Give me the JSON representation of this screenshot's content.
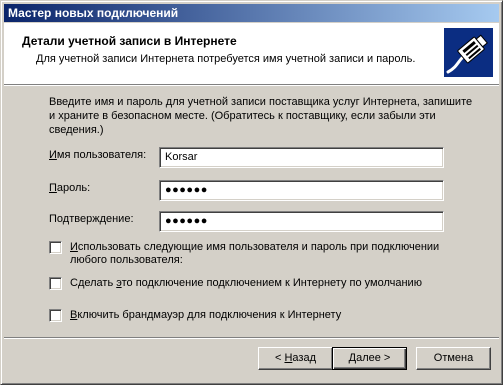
{
  "window": {
    "title": "Мастер новых подключений"
  },
  "header": {
    "title": "Детали учетной записи в Интернете",
    "subtitle": "Для учетной записи Интернета потребуется имя учетной записи и пароль.",
    "icon": "network-cable-icon"
  },
  "intro_text": "Введите имя и пароль для учетной записи поставщика услуг Интернета, запишите и храните в безопасном месте. (Обратитесь к поставщику, если забыли эти сведения.)",
  "fields": {
    "username": {
      "label_pre": "",
      "label_accel": "И",
      "label_post": "мя пользователя:",
      "value": "Korsar"
    },
    "password": {
      "label_pre": "",
      "label_accel": "П",
      "label_post": "ароль:",
      "value": "●●●●●●"
    },
    "confirm": {
      "label_pre": "По",
      "label_accel": "д",
      "label_post": "тверждение:",
      "value": "●●●●●●"
    }
  },
  "checkboxes": {
    "use_for_all": {
      "label_pre": "",
      "label_accel": "И",
      "label_post": "спользовать следующие имя пользователя и пароль при подключении любого пользователя:",
      "checked": false
    },
    "default_connection": {
      "label_pre": "Сделать ",
      "label_accel": "э",
      "label_post": "то подключение подключением к Интернету по умолчанию",
      "checked": false
    },
    "firewall": {
      "label_pre": "",
      "label_accel": "В",
      "label_post": "ключить брандмауэр для подключения к Интернету",
      "checked": false
    }
  },
  "buttons": {
    "back": {
      "prefix": "< ",
      "accel": "Н",
      "rest": "азад"
    },
    "next": {
      "accel": "Д",
      "rest": "алее >"
    },
    "cancel": {
      "label": "Отмена"
    }
  },
  "colors": {
    "titlebar_start": "#0a246a",
    "titlebar_end": "#a6caf0",
    "dialog_face": "#d4d0c8",
    "header_bg": "#ffffff"
  }
}
